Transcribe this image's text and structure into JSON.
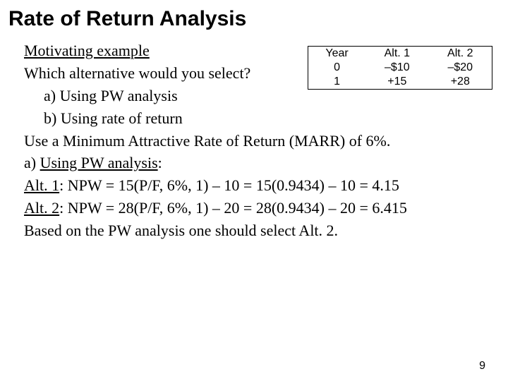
{
  "title": "Rate of Return Analysis",
  "table": {
    "h1": "Year",
    "h2": "Alt. 1",
    "h3": "Alt. 2",
    "r1c1": "0",
    "r1c2": "–$10",
    "r1c3": "–$20",
    "r2c1": "1",
    "r2c2": "+15",
    "r2c3": "+28"
  },
  "body": {
    "motivating": "Motivating example",
    "which": "Which alternative would you select?",
    "opt_a": "a) Using PW analysis",
    "opt_b": "b) Using rate of return",
    "marr": "Use a Minimum Attractive Rate of Return (MARR) of 6%.",
    "part_a_label": "a) ",
    "part_a_underline": "Using PW analysis",
    "part_a_after": ":",
    "alt1_label": "Alt. 1",
    "alt1_rest": ": NPW = 15(P/F, 6%, 1) – 10 = 15(0.9434) – 10 = 4.15",
    "alt2_label": "Alt. 2",
    "alt2_rest": ": NPW = 28(P/F, 6%, 1) – 20 = 28(0.9434) – 20 = 6.415",
    "conclusion": "Based on the PW analysis one should select Alt. 2."
  },
  "page_number": "9"
}
